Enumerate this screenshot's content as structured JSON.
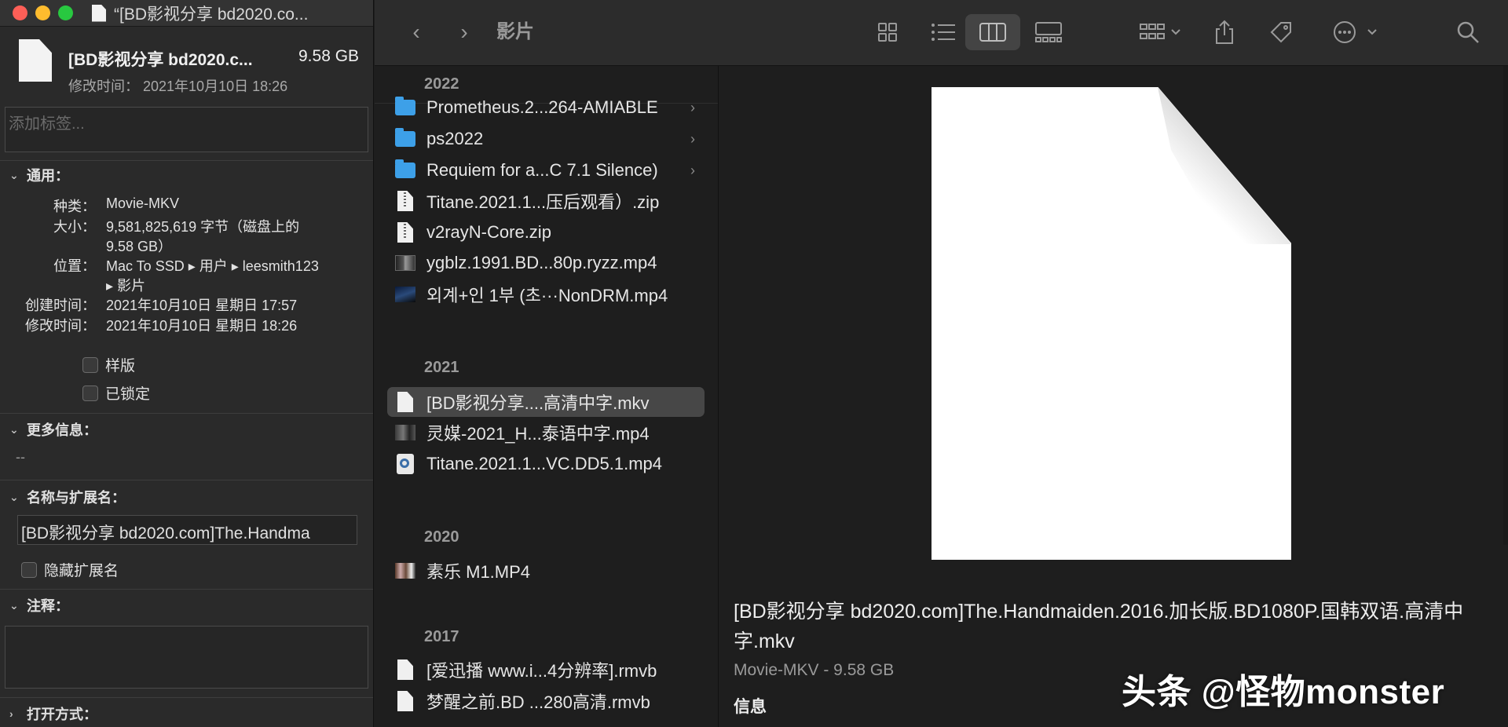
{
  "info_panel": {
    "window_title": "“[BD影视分享 bd2020.co...",
    "file_name": "[BD影视分享 bd2020.c...",
    "file_size": "9.58 GB",
    "modified_summary": "修改时间： 2021年10月10日 18:26",
    "tags_placeholder": "添加标签...",
    "general": {
      "header": "通用：",
      "kind_label": "种类：",
      "kind_value": "Movie-MKV",
      "size_label": "大小：",
      "size_value_1": "9,581,825,619 字节（磁盘上的",
      "size_value_2": "9.58 GB）",
      "where_label": "位置：",
      "where_value_1": "Mac To SSD ▸ 用户 ▸ leesmith123",
      "where_value_2": "▸ 影片",
      "created_label": "创建时间：",
      "created_value": "2021年10月10日 星期日 17:57",
      "modified_label": "修改时间：",
      "modified_value": "2021年10月10日 星期日 18:26",
      "stationery_label": "样版",
      "locked_label": "已锁定"
    },
    "more_info": {
      "header": "更多信息：",
      "value": "--"
    },
    "name_ext": {
      "header": "名称与扩展名：",
      "name_value": "[BD影视分享 bd2020.com]The.Handma",
      "hide_ext_label": "隐藏扩展名"
    },
    "comments": {
      "header": "注释："
    },
    "open_with": {
      "header": "打开方式："
    }
  },
  "finder": {
    "breadcrumb": "影片",
    "toolbar_icons": [
      "chevron-left-icon",
      "chevron-right-icon",
      "icon-view-icon",
      "list-view-icon",
      "column-view-icon",
      "gallery-view-icon",
      "group-icon",
      "share-icon",
      "tag-icon",
      "more-icon",
      "search-icon"
    ],
    "groups": [
      {
        "year": "2022",
        "items": [
          {
            "name": "Prometheus.2...264-AMIABLE",
            "type": "folder",
            "arrow": "›"
          },
          {
            "name": "ps2022",
            "type": "folder",
            "arrow": "›"
          },
          {
            "name": "Requiem for a...C 7.1 Silence)",
            "type": "folder",
            "arrow": "›"
          },
          {
            "name": "Titane.2021.1...压后观看）.zip",
            "type": "zip"
          },
          {
            "name": "v2rayN-Core.zip",
            "type": "zip"
          },
          {
            "name": "ygblz.1991.BD...80p.ryzz.mp4",
            "type": "thumb"
          },
          {
            "name": "외계+인 1부 (초···NonDRM.mp4",
            "type": "thumb2"
          }
        ]
      },
      {
        "year": "2021",
        "items": [
          {
            "name": "[BD影视分享....高清中字.mkv",
            "type": "doc",
            "selected": true
          },
          {
            "name": "灵媒-2021_H...泰语中字.mp4",
            "type": "thumb3"
          },
          {
            "name": "Titane.2021.1...VC.DD5.1.mp4",
            "type": "qt"
          }
        ]
      },
      {
        "year": "2020",
        "items": [
          {
            "name": "素乐 M1.MP4",
            "type": "thumb4"
          }
        ]
      },
      {
        "year": "2017",
        "items": [
          {
            "name": "[爱迅播 www.i...4分辨率].rmvb",
            "type": "doc"
          },
          {
            "name": "梦醒之前.BD ...280高清.rmvb",
            "type": "doc"
          }
        ]
      }
    ],
    "preview": {
      "name": "[BD影视分享 bd2020.com]The.Handmaiden.2016.加长版.BD1080P.国韩双语.高清中字.mkv",
      "kind_size": "Movie-MKV - 9.58 GB",
      "info_label": "信息"
    }
  },
  "watermark": "头条 @怪物monster"
}
